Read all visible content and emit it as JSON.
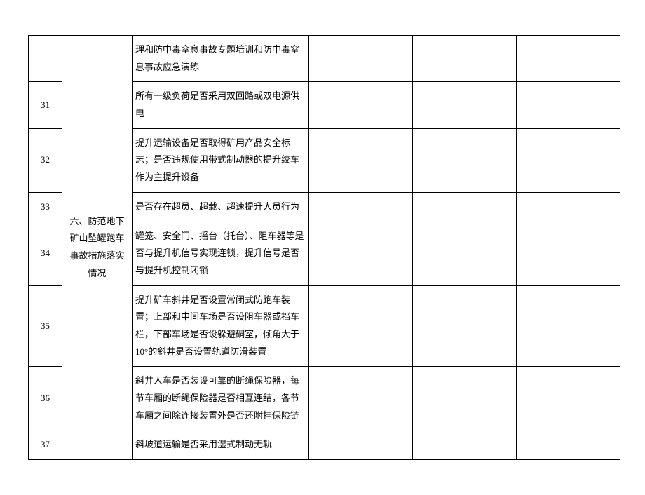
{
  "category": "六、防范地下矿山坠罐跑车事故措施落实情况",
  "rows": [
    {
      "num": "",
      "desc": "理和防中毒窒息事故专题培训和防中毒窒息事故应急演练"
    },
    {
      "num": "31",
      "desc": "所有一级负荷是否采用双回路或双电源供电"
    },
    {
      "num": "32",
      "desc": "提升运输设备是否取得矿用产品安全标志；是否违规使用带式制动器的提升绞车作为主提升设备"
    },
    {
      "num": "33",
      "desc": "是否存在超员、超载、超速提升人员行为"
    },
    {
      "num": "34",
      "desc": "罐笼、安全门、摇台（托台）、阻车器等是否与提升机信号实现连锁，提升信号是否与提升机控制闭锁"
    },
    {
      "num": "35",
      "desc": "提升矿车斜井是否设置常闭式防跑车装置；上部和中间车场是否设阻车器或挡车栏，下部车场是否设躲避硐室，倾角大于 10°的斜井是否设置轨道防滑装置"
    },
    {
      "num": "36",
      "desc": "斜井人车是否装设可靠的断绳保险器，每节车厢的断绳保险器是否相互连结，各节车厢之间除连接装置外是否还附挂保险链"
    },
    {
      "num": "37",
      "desc": "斜坡道运输是否采用湿式制动无轨"
    }
  ]
}
